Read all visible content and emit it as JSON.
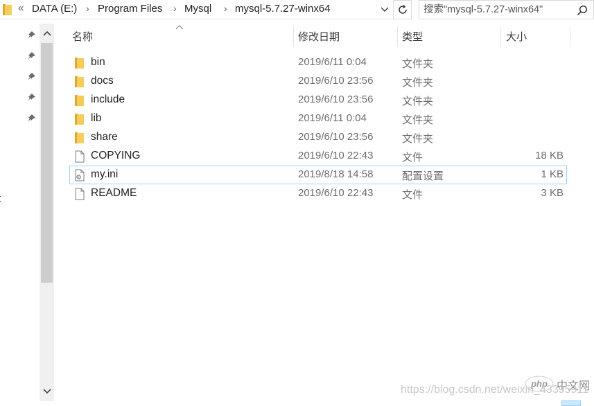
{
  "address": {
    "overflow_icon": "double-chevron-left-icon",
    "crumbs": [
      "DATA (E:)",
      "Program Files",
      "Mysql",
      "mysql-5.7.27-winx64"
    ],
    "separator": "›"
  },
  "search": {
    "placeholder": "搜索\"mysql-5.7.27-winx64\""
  },
  "nav": {
    "pinned_count": 5,
    "stray_text": "t"
  },
  "columns": {
    "name": "名称",
    "date": "修改日期",
    "type": "类型",
    "size": "大小"
  },
  "files": [
    {
      "name": "bin",
      "date": "2019/6/11 0:04",
      "type": "文件夹",
      "size": "",
      "icon": "folder-icon"
    },
    {
      "name": "docs",
      "date": "2019/6/10 23:56",
      "type": "文件夹",
      "size": "",
      "icon": "folder-icon"
    },
    {
      "name": "include",
      "date": "2019/6/10 23:56",
      "type": "文件夹",
      "size": "",
      "icon": "folder-icon"
    },
    {
      "name": "lib",
      "date": "2019/6/11 0:04",
      "type": "文件夹",
      "size": "",
      "icon": "folder-icon"
    },
    {
      "name": "share",
      "date": "2019/6/10 23:56",
      "type": "文件夹",
      "size": "",
      "icon": "folder-icon"
    },
    {
      "name": "COPYING",
      "date": "2019/6/10 22:43",
      "type": "文件",
      "size": "18 KB",
      "icon": "file-icon"
    },
    {
      "name": "my.ini",
      "date": "2019/8/18 14:58",
      "type": "配置设置",
      "size": "1 KB",
      "icon": "settings-file-icon"
    },
    {
      "name": "README",
      "date": "2019/6/10 22:43",
      "type": "文件",
      "size": "3 KB",
      "icon": "file-icon"
    }
  ],
  "watermark": {
    "url": "https://blog.csdn.net/weixin_43395911",
    "logo_text": "php",
    "logo_suffix": "中文网"
  },
  "colors": {
    "selection_border": "#99d1ff",
    "folder": "#f3c34a",
    "scroll_thumb": "#cdcdcd"
  }
}
